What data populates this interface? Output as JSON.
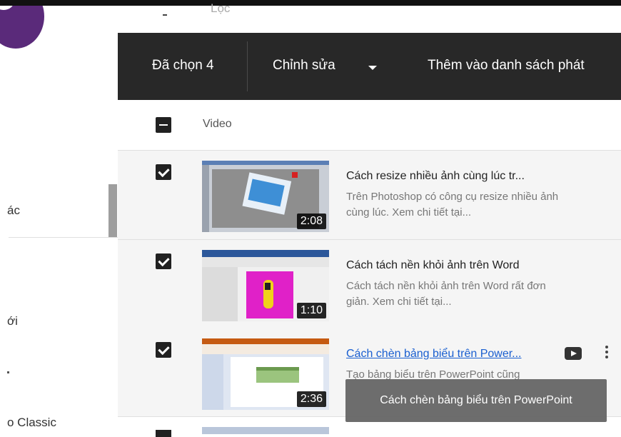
{
  "sidebar": {
    "items": [
      {
        "label": "ác"
      },
      {
        "label": "ới"
      },
      {
        "label": "o Classic"
      }
    ]
  },
  "filter": {
    "label": "Lọc"
  },
  "action_bar": {
    "selected": "Đã chọn 4",
    "edit": "Chỉnh sửa",
    "add_to_playlist": "Thêm vào danh sách phát"
  },
  "table": {
    "header": "Video",
    "rows": [
      {
        "title": "Cách resize nhiều ảnh cùng lúc tr...",
        "description": "Trên Photoshop có công cụ resize nhiều ảnh cùng lúc. Xem chi tiết tại...",
        "duration": "2:08",
        "checked": true
      },
      {
        "title": "Cách tách nền khỏi ảnh trên Word",
        "description": "Cách tách nền khỏi ảnh trên Word rất đơn giản. Xem chi tiết tại...",
        "duration": "1:10",
        "checked": true
      },
      {
        "title": "Cách chèn bảng biểu trên Power...",
        "description": "Tạo bảng biểu trên PowerPoint cũng",
        "duration": "2:36",
        "checked": true
      }
    ]
  },
  "tooltip": "Cách chèn bảng biểu trên PowerPoint",
  "colors": {
    "action_bar": "#282828",
    "link": "#1a5fd0",
    "row_bg": "#f5f5f5"
  }
}
